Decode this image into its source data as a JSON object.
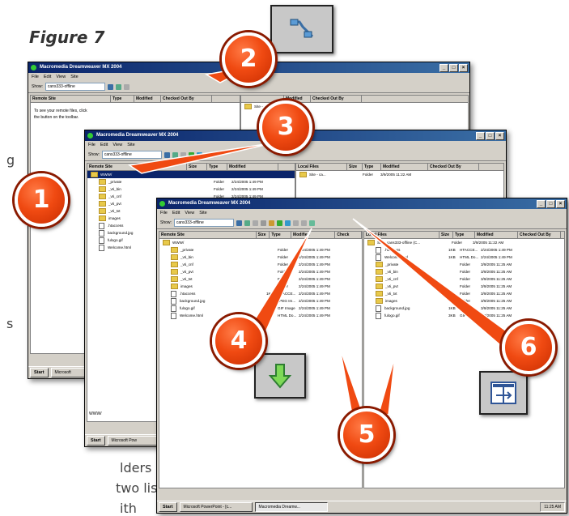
{
  "figure_title": "Figure 7",
  "side_text": {
    "g": "g",
    "s": "s",
    "folders": "lders",
    "two_list": "two list",
    "with": "ith"
  },
  "callouts": [
    "1",
    "2",
    "3",
    "4",
    "5",
    "6"
  ],
  "window1": {
    "title": "Macromedia Dreamweaver MX 2004",
    "menu": [
      "File",
      "Edit",
      "View",
      "Site"
    ],
    "show_label": "Show:",
    "site": "cans333-offline",
    "remote_header": "Remote Site",
    "columns": [
      "Type",
      "Modified",
      "Checked Out By"
    ],
    "local_columns": [
      "",
      "Modified",
      "Checked Out By"
    ],
    "remote_message": "To see your remote files, click the  button on the toolbar.",
    "local_item": "Site -",
    "taskbar": {
      "start": "Start",
      "task": "Microsoft"
    }
  },
  "window2": {
    "title": "Macromedia Dreamweaver MX 2004",
    "menu": [
      "File",
      "Edit",
      "View",
      "Site"
    ],
    "show_label": "Show:",
    "site": "cans333-offline",
    "remote_header": "Remote Site",
    "columns": [
      "Size",
      "Type",
      "Modified"
    ],
    "local_columns": [
      "Local Files",
      "Size",
      "Type",
      "Modified",
      "Checked Out By"
    ],
    "rows": [
      {
        "name": "WWW/",
        "type": "",
        "modified": "",
        "selected": true
      },
      {
        "name": "_private",
        "type": "Folder",
        "modified": "2/24/2005 1:49 PM"
      },
      {
        "name": "_vti_bin",
        "type": "Folder",
        "modified": "2/24/2005 1:49 PM"
      },
      {
        "name": "_vti_cnf",
        "type": "Folder",
        "modified": "2/24/2005 1:49 PM"
      },
      {
        "name": "_vti_pvt",
        "type": "Folder",
        "modified": "2/24/2005 1:49 PM"
      },
      {
        "name": "_vti_txt",
        "type": "Folder",
        "modified": "2/24/2005 1:49 PM"
      },
      {
        "name": "images",
        "type": "Folder",
        "modified": "2/24/2005 1:49 PM"
      },
      {
        "name": ".htaccess",
        "type": "",
        "modified": ""
      },
      {
        "name": "background.jpg",
        "type": "",
        "modified": ""
      },
      {
        "name": "fulogo.gif",
        "type": "",
        "modified": ""
      },
      {
        "name": "Welcome.html",
        "type": "",
        "modified": ""
      }
    ],
    "local_row": {
      "name": "Site - ca...",
      "type": "Folder",
      "modified": "3/9/2005 11:22 AM"
    },
    "status": "WWW/",
    "taskbar": {
      "start": "Start",
      "task": "Microsoft Pow"
    }
  },
  "window3": {
    "title": "Macromedia Dreamweaver MX 2004",
    "menu": [
      "File",
      "Edit",
      "View",
      "Site"
    ],
    "show_label": "Show:",
    "site": "cans333-offline",
    "remote_header": "Remote Site",
    "remote_columns": [
      "Size",
      "Type",
      "Modified",
      "Check"
    ],
    "local_columns": [
      "Local Files",
      "Size",
      "Type",
      "Modified",
      "Checked Out By"
    ],
    "remote_rows": [
      {
        "name": "WWW/",
        "size": "",
        "type": "",
        "modified": ""
      },
      {
        "name": "_private",
        "size": "",
        "type": "Folder",
        "modified": "2/24/2005 1:49 PM"
      },
      {
        "name": "_vti_bin",
        "size": "",
        "type": "Folder",
        "modified": "2/24/2005 1:49 PM"
      },
      {
        "name": "_vti_cnf",
        "size": "",
        "type": "Folder",
        "modified": "2/24/2005 1:49 PM"
      },
      {
        "name": "_vti_pvt",
        "size": "",
        "type": "Folder",
        "modified": "2/24/2005 1:49 PM"
      },
      {
        "name": "_vti_txt",
        "size": "",
        "type": "Folder",
        "modified": "2/24/2005 1:49 PM"
      },
      {
        "name": "images",
        "size": "",
        "type": "Folder",
        "modified": "2/24/2005 1:49 PM"
      },
      {
        "name": ".htaccess",
        "size": "1KB",
        "type": "HTACCE...",
        "modified": "2/24/2005 1:49 PM"
      },
      {
        "name": "background.jpg",
        "size": "1KB",
        "type": "JPEG Im...",
        "modified": "2/24/2005 1:49 PM"
      },
      {
        "name": "fulogo.gif",
        "size": "3KB",
        "type": "GIF Image",
        "modified": "2/24/2005 1:49 PM"
      },
      {
        "name": "Welcome.html",
        "size": "1KB",
        "type": "HTML Do...",
        "modified": "2/24/2005 1:49 PM"
      }
    ],
    "local_rows": [
      {
        "name": "Site - cans333-offline (C...",
        "size": "",
        "type": "Folder",
        "modified": "3/9/2005 11:22 AM"
      },
      {
        "name": ".htaccess",
        "size": "1KB",
        "type": "HTACCE...",
        "modified": "2/24/2005 1:49 PM"
      },
      {
        "name": "Welcome.html",
        "size": "1KB",
        "type": "HTML Do...",
        "modified": "2/24/2005 1:49 PM"
      },
      {
        "name": "_private",
        "size": "",
        "type": "Folder",
        "modified": "3/9/2005 11:25 AM"
      },
      {
        "name": "_vti_bin",
        "size": "",
        "type": "Folder",
        "modified": "3/9/2005 11:25 AM"
      },
      {
        "name": "_vti_cnf",
        "size": "",
        "type": "Folder",
        "modified": "3/9/2005 11:25 AM"
      },
      {
        "name": "_vti_pvt",
        "size": "",
        "type": "Folder",
        "modified": "3/9/2005 11:25 AM"
      },
      {
        "name": "_vti_txt",
        "size": "",
        "type": "Folder",
        "modified": "3/9/2005 11:25 AM"
      },
      {
        "name": "images",
        "size": "",
        "type": "Folder",
        "modified": "3/9/2005 11:25 AM"
      },
      {
        "name": "background.jpg",
        "size": "1KB",
        "type": "JPEG Im...",
        "modified": "3/9/2005 11:25 AM"
      },
      {
        "name": "fulogo.gif",
        "size": "3KB",
        "type": "GIF Image",
        "modified": "3/9/2005 11:25 AM"
      }
    ],
    "taskbar": {
      "start": "Start",
      "task1": "Microsoft PowerPoint - [c...",
      "task2": "Macromedia Dreamw...",
      "clock": "11:25 AM"
    }
  },
  "icons": {
    "connect": "connect-plug-icon",
    "get": "get-down-arrow-icon",
    "expand": "expand-panel-icon"
  },
  "colors": {
    "callout": "#f04a12",
    "titlebar": "#0a246a",
    "win_face": "#d4d0c8"
  }
}
